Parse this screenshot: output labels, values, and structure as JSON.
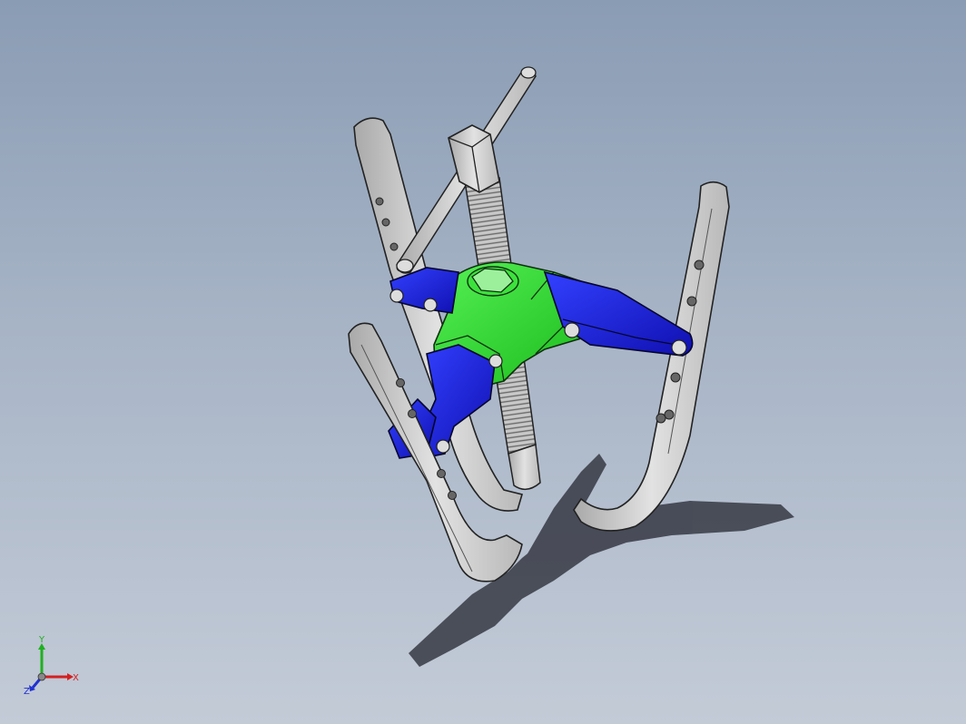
{
  "viewport": {
    "background_top": "#8a9cb4",
    "background_bottom": "#c3cbd7"
  },
  "model": {
    "hub_color": "#22dd22",
    "link_color": "#1a22dd",
    "steel_color": "#cfcfcf",
    "parts": [
      "hex-bolt-head",
      "threaded-screw",
      "t-handle-bar",
      "hub",
      "link-plates",
      "jaw-left",
      "jaw-front",
      "jaw-right",
      "shadow"
    ]
  },
  "triad": {
    "x_label": "X",
    "y_label": "Y",
    "z_label": "Z",
    "x_color": "#d42020",
    "y_color": "#20b020",
    "z_color": "#2030d0"
  }
}
